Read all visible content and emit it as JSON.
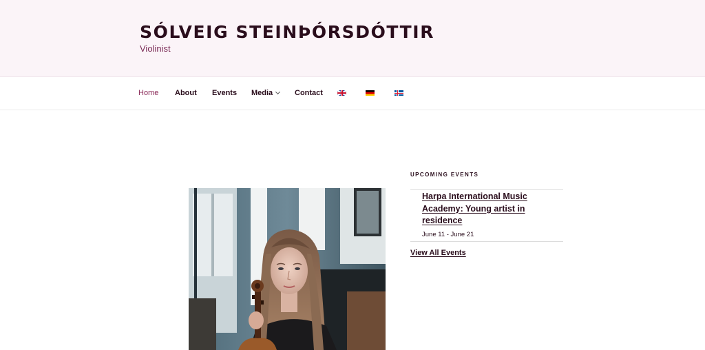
{
  "site": {
    "title": "SÓLVEIG STEINÞÓRSDÓTTIR",
    "description": "Violinist"
  },
  "nav": {
    "items": [
      {
        "label": "Home",
        "current": true
      },
      {
        "label": "About"
      },
      {
        "label": "Events"
      },
      {
        "label": "Media",
        "has_submenu": true
      },
      {
        "label": "Contact"
      }
    ],
    "languages": [
      "flag-uk-icon",
      "flag-germany-icon",
      "flag-iceland-icon"
    ]
  },
  "colors": {
    "header_bg": "#fbf4f8",
    "title": "#2a0d1c",
    "accent": "#8a2a58"
  },
  "sidebar": {
    "widget_title": "UPCOMING EVENTS",
    "events": [
      {
        "title": "Harpa International Music Academy: Young artist in residence",
        "date": "June 11 - June 21"
      }
    ],
    "view_all": "View All Events"
  }
}
